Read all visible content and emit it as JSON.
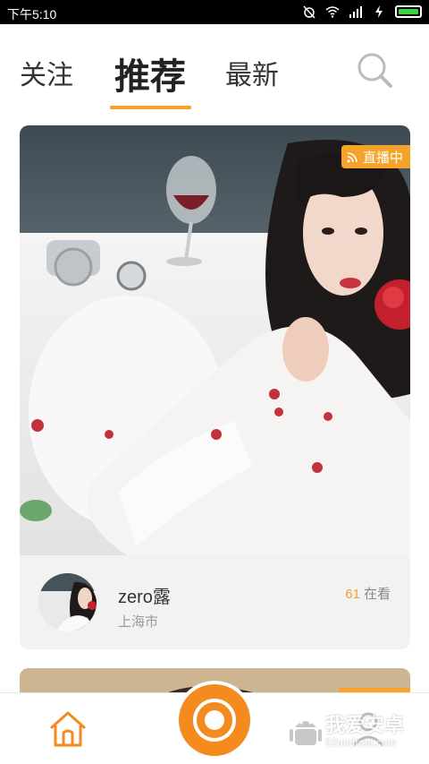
{
  "status_bar": {
    "time": "下午5:10",
    "icons": [
      "alarm-off-icon",
      "wifi-icon",
      "signal-icon",
      "charging-icon",
      "battery-icon"
    ],
    "battery_color": "#3fd23f"
  },
  "top_nav": {
    "tabs": [
      {
        "label": "关注"
      },
      {
        "label": "推荐",
        "active": true
      },
      {
        "label": "最新"
      }
    ],
    "accent_color": "#f5a32a",
    "search_icon": "search-icon"
  },
  "feed": {
    "cards": [
      {
        "live_badge": "直播中",
        "badge_icon": "rss-icon",
        "host_name": "zero露",
        "host_city": "上海市",
        "viewer_count": "61",
        "viewer_label": "在看"
      }
    ]
  },
  "bottom_bar": {
    "items": [
      {
        "name": "home",
        "icon": "home-icon"
      },
      {
        "name": "go-live",
        "icon": "live-record-icon"
      },
      {
        "name": "me",
        "icon": "user-icon"
      }
    ],
    "watermark_title": "我爱安卓",
    "watermark_sub": "52android.com"
  }
}
